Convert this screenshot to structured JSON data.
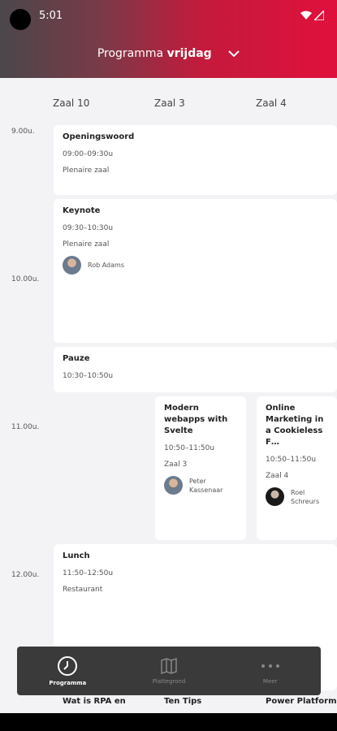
{
  "status": {
    "time": "5:01"
  },
  "header": {
    "title_prefix": "Programma",
    "title_day": "vrijdag"
  },
  "columns": [
    "Zaal 10",
    "Zaal 3",
    "Zaal 4"
  ],
  "time_labels": [
    "9.00u.",
    "10.00u.",
    "11.00u.",
    "12.00u."
  ],
  "sessions": [
    {
      "title": "Openingswoord",
      "time": "09:00–09:30u",
      "room": "Plenaire zaal"
    },
    {
      "title": "Keynote",
      "time": "09:30–10:30u",
      "room": "Plenaire zaal",
      "speaker": "Rob Adams"
    },
    {
      "title": "Pauze",
      "time": "10:30–10:50u"
    },
    {
      "title": "Modern webapps with Svelte",
      "time": "10:50–11:50u",
      "room": "Zaal 3",
      "speaker": "Peter Kassenaar"
    },
    {
      "title": "Online Marketing in a Cookieless F…",
      "time": "10:50–11:50u",
      "room": "Zaal 4",
      "speaker": "Roel Schreurs"
    },
    {
      "title": "Lunch",
      "time": "11:50–12:50u",
      "room": "Restaurant"
    }
  ],
  "peek_titles": [
    "Wat is RPA en",
    "Ten Tips",
    "Power Platform"
  ],
  "nav": [
    {
      "label": "Programma",
      "icon": "clock-icon"
    },
    {
      "label": "Plattegrond",
      "icon": "map-icon"
    },
    {
      "label": "Meer",
      "icon": "more-icon"
    }
  ]
}
